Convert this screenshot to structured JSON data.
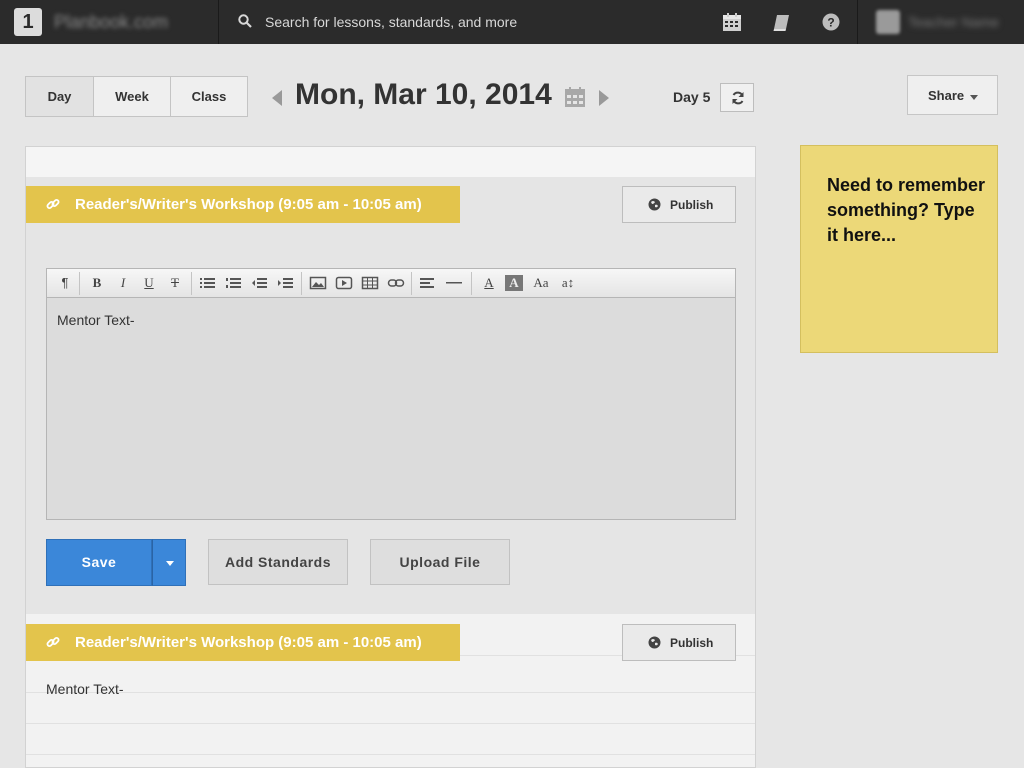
{
  "topbar": {
    "brand_logo": "1",
    "brand_name": "Planbook.com",
    "search_placeholder": "Search for lessons, standards, and more",
    "icons": [
      "calendar-icon",
      "book-icon",
      "help-icon"
    ],
    "user_name": "Teacher Name"
  },
  "views": {
    "day": "Day",
    "week": "Week",
    "class": "Class",
    "active": "Day"
  },
  "date": {
    "title": "Mon, Mar 10, 2014",
    "day_label": "Day 5"
  },
  "share": {
    "label": "Share"
  },
  "lessons": [
    {
      "title": "Reader's/Writer's Workshop (9:05 am - 10:05 am)",
      "publish_label": "Publish",
      "content": "Mentor Text-"
    },
    {
      "title": "Reader's/Writer's Workshop (9:05 am - 10:05 am)",
      "publish_label": "Publish",
      "content": "Mentor Text-"
    }
  ],
  "toolbar": {
    "paragraph": "¶",
    "bold": "B",
    "italic": "I",
    "underline": "U",
    "strike": "T",
    "text_color": "A",
    "bg_color": "A",
    "font_size": "Aa",
    "line_height": "a↕"
  },
  "actions": {
    "save": "Save",
    "add_standards": "Add Standards",
    "upload_file": "Upload File"
  },
  "sticky_note": {
    "text": "Need to remember something? Type it here..."
  },
  "colors": {
    "topbar": "#2b2b2b",
    "lesson_banner": "#e3c44c",
    "save_button": "#3b87d9",
    "sticky_note": "#ecd878"
  }
}
